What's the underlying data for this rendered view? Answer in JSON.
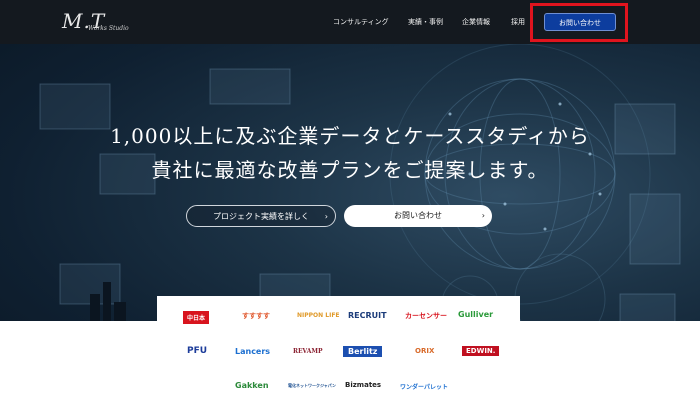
{
  "header": {
    "logo": "M.T",
    "logo_sub": "Works Studio",
    "nav": [
      "コンサルティング",
      "実績・事例",
      "企業情報",
      "採用"
    ],
    "contact_button": "お問い合わせ"
  },
  "hero": {
    "headline_line1": "1,000以上に及ぶ企業データとケーススタディから",
    "headline_line2": "貴社に最適な改善プランをご提案します。",
    "button_projects": "プロジェクト実績を詳しく",
    "button_contact": "お問い合わせ",
    "arrow": "›"
  },
  "clients": {
    "row1": [
      "中日本",
      "すすすす",
      "NIPPON LIFE",
      "RECRUIT",
      "カーセンサー",
      "Gulliver"
    ],
    "row2": [
      "PFU",
      "Lancers",
      "REVAMP",
      "Berlitz",
      "ORIX",
      "EDWIN."
    ],
    "row3": [
      "Gakken",
      "電化ネットワークジャパン",
      "Bizmates",
      "ワンダーパレット"
    ]
  },
  "colors": {
    "header_bg": "#14191f",
    "contact_bg": "#0d3d9e",
    "highlight": "#e0141e",
    "hero_bg": "#0f2031"
  }
}
